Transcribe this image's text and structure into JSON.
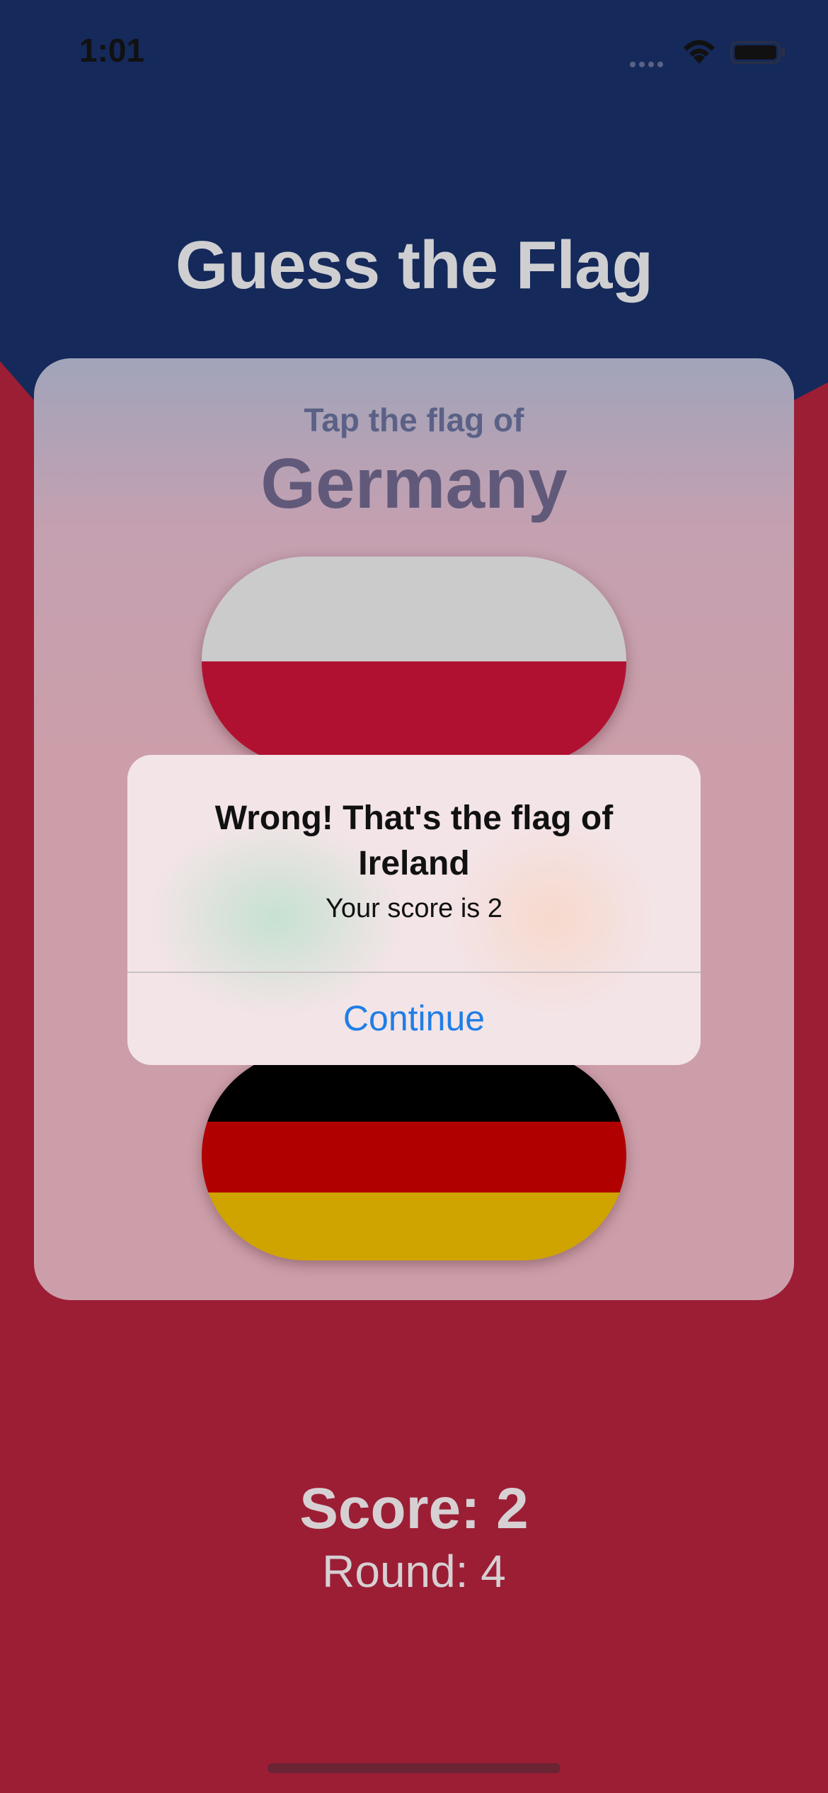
{
  "status_bar": {
    "time": "1:01"
  },
  "colors": {
    "top_background": "#15295a",
    "bottom_background": "#9b1e35",
    "alert_button_text": "#1f7ee6"
  },
  "app": {
    "title": "Guess the Flag"
  },
  "card": {
    "prompt": "Tap the flag of",
    "country": "Germany",
    "flags": [
      {
        "country": "Poland",
        "stripes": [
          "#cbcbcb",
          "#b01131"
        ]
      },
      {
        "country": "Germany",
        "stripes": [
          "#000000",
          "#b00000",
          "#cfa300"
        ]
      }
    ]
  },
  "alert": {
    "title": "Wrong! That's the flag of Ireland",
    "message": "Your score is 2",
    "button_label": "Continue"
  },
  "footer": {
    "score": "Score: 2",
    "round": "Round: 4"
  }
}
